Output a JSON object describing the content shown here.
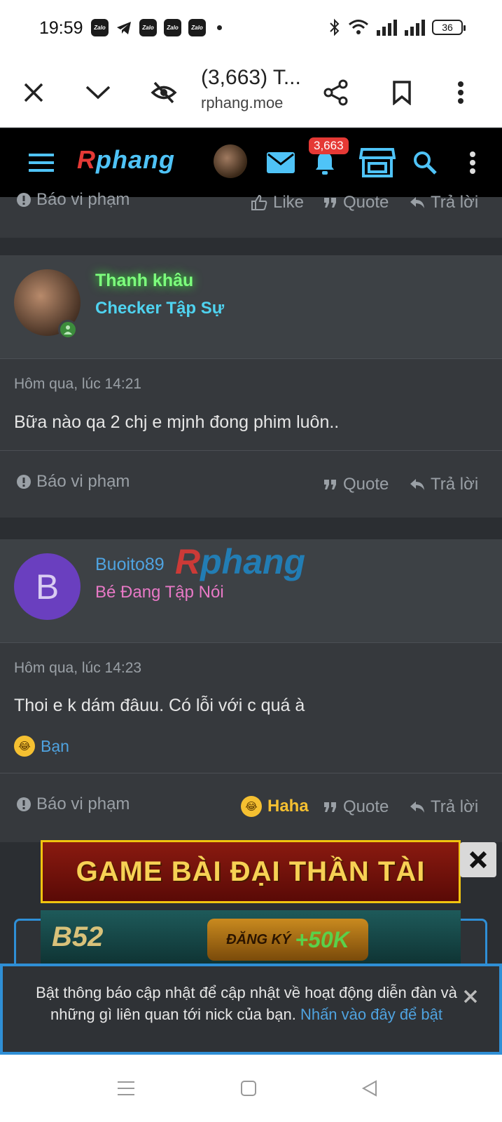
{
  "status_bar": {
    "time": "19:59",
    "app_icons": [
      "Zalo",
      "telegram-icon",
      "Zalo",
      "Zalo",
      "Zalo"
    ],
    "battery": "36"
  },
  "browser": {
    "title": "(3,663) T...",
    "url": "rphang.moe"
  },
  "site_header": {
    "logo_r": "R",
    "logo_rest": "phang",
    "notification_count": "3,663"
  },
  "actions": {
    "report": "Báo vi phạm",
    "like": "Like",
    "quote": "Quote",
    "reply": "Trả lời",
    "haha": "Haha"
  },
  "posts": [
    {
      "username": "Thanh khâu",
      "user_title": "Checker Tập Sự",
      "username_color": "#7dff7d",
      "title_color": "#4fd3f0",
      "time": "Hôm qua, lúc 14:21",
      "text": "Bữa nào qa 2 chj e mjnh đong phim luôn.."
    },
    {
      "avatar_letter": "B",
      "username": "Buoito89",
      "user_title": "Bé Đang Tập Nói",
      "username_color": "#4fa3e0",
      "title_color": "#e879c6",
      "time": "Hôm qua, lúc 14:23",
      "text": "Thoi e k dám đâuu. Có lỗi với c quá à",
      "reaction_by": "Bạn"
    }
  ],
  "watermark": {
    "r": "R",
    "rest": "phang"
  },
  "ads": {
    "banner1": "GAME BÀI ĐẠI THẦN TÀI",
    "banner2_brand": "B52",
    "banner2_cta": "ĐĂNG KÝ",
    "banner2_bonus": "+50K"
  },
  "notification_bar": {
    "text": "Bật thông báo cập nhật để cập nhật về hoạt động diễn đàn và những gì liên quan tới nick của bạn.",
    "link": "Nhấn vào đây để bật"
  }
}
